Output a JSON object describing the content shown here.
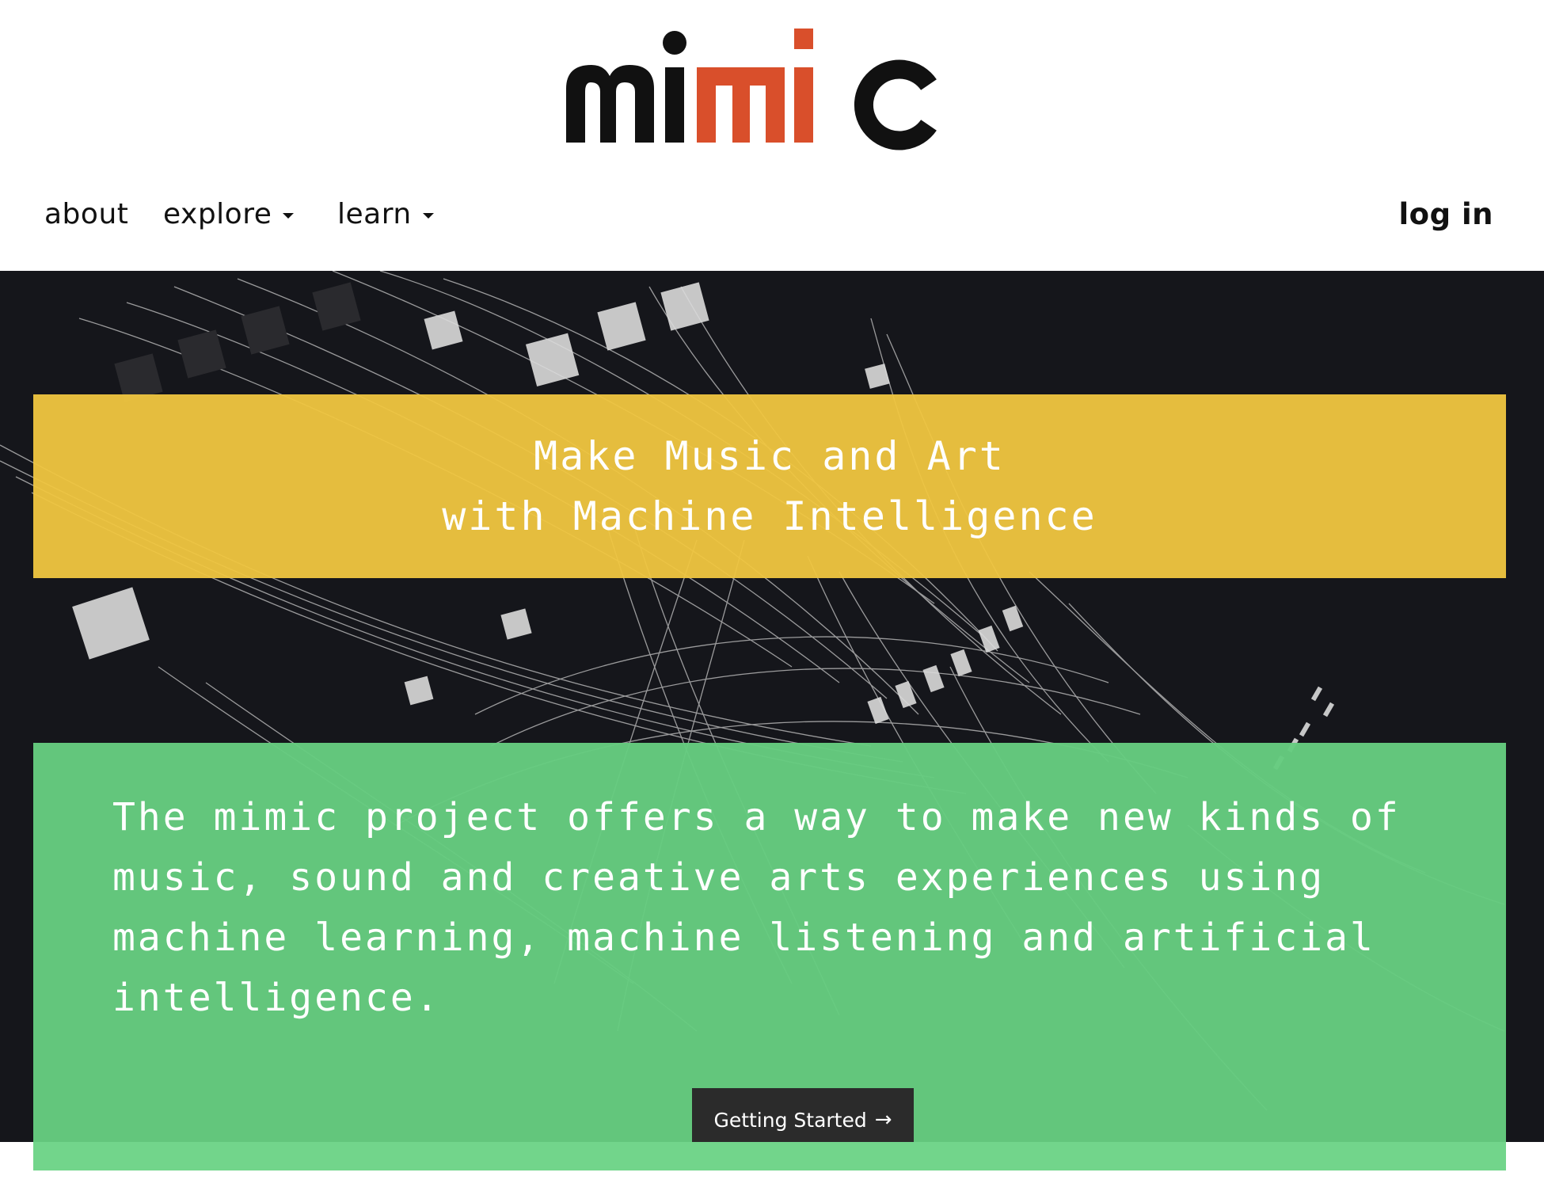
{
  "brand": {
    "name": "mimic",
    "letters": [
      "m",
      "i",
      "m",
      "i",
      "c"
    ],
    "colors": {
      "dark": "#111111",
      "accent": "#d94f2b"
    }
  },
  "nav": {
    "about": "about",
    "explore": "explore",
    "learn": "learn",
    "login": "log in"
  },
  "hero": {
    "headline_line1": "Make Music and Art",
    "headline_line2": "with Machine Intelligence",
    "intro": "The mimic project offers a way to make new kinds of music, sound and creative arts experiences using machine learning, machine listening and artificial intelligence.",
    "cta_label": "Getting Started",
    "cta_icon": "arrow-right-icon"
  },
  "colors": {
    "hero_background": "#15161b",
    "headline_panel": "#f0c640",
    "intro_panel": "#66cc80",
    "cta_background": "#2b2b2b"
  }
}
